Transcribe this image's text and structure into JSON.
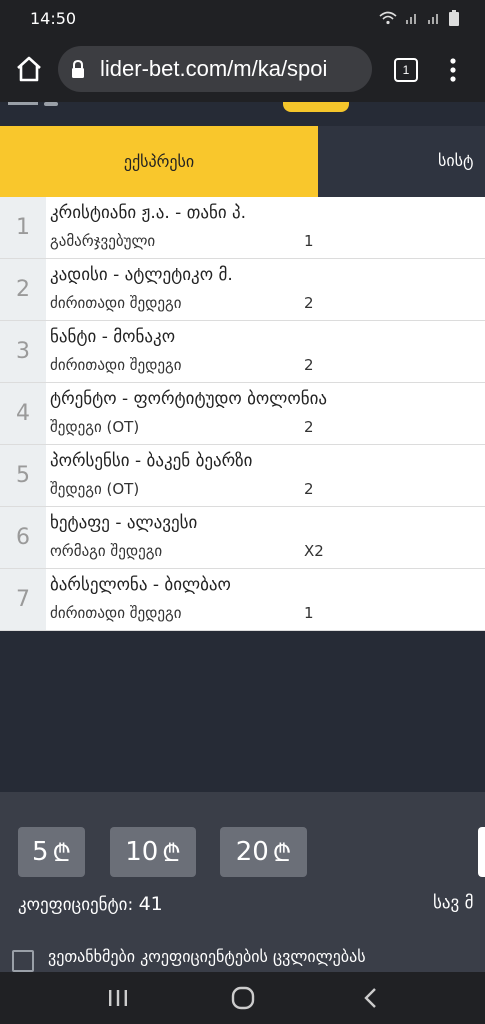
{
  "status_bar": {
    "time": "14:50"
  },
  "browser": {
    "url": "lider-bet.com/m/ka/spoi",
    "tab_count": "1"
  },
  "tabs": {
    "express": "ექსპრესი",
    "system": "სისტ"
  },
  "bets": [
    {
      "num": "1",
      "match": "კრისტიანი ჟ.ა. - თანი პ.",
      "market": "გამარჯვებული",
      "pick": "1"
    },
    {
      "num": "2",
      "match": "კადისი - ატლეტიკო მ.",
      "market": "ძირითადი შედეგი",
      "pick": "2"
    },
    {
      "num": "3",
      "match": "ნანტი - მონაკო",
      "market": "ძირითადი შედეგი",
      "pick": "2"
    },
    {
      "num": "4",
      "match": "ტრენტო - ფორტიტუდო ბოლონია",
      "market": "შედეგი (OT)",
      "pick": "2"
    },
    {
      "num": "5",
      "match": "პორსენსი - ბაკენ ბეარზი",
      "market": "შედეგი (OT)",
      "pick": "2"
    },
    {
      "num": "6",
      "match": "ხეტაფე - ალავესი",
      "market": "ორმაგი შედეგი",
      "pick": "X2"
    },
    {
      "num": "7",
      "match": "ბარსელონა - ბილბაო",
      "market": "ძირითადი შედეგი",
      "pick": "1"
    }
  ],
  "stakes": {
    "currency_symbol": "₾",
    "items": [
      {
        "value": "5"
      },
      {
        "value": "10"
      },
      {
        "value": "20"
      }
    ]
  },
  "summary": {
    "coef_label": "კოეფიციენტი:",
    "coef_value": "41",
    "sav_label": "სავ მ"
  },
  "agree": {
    "text": "ვეთანხმები კოეფიციენტების ცვლილებას",
    "checked": false
  },
  "colors": {
    "accent": "#f9c72c",
    "panel": "#3a3e48",
    "background": "#262b36"
  }
}
